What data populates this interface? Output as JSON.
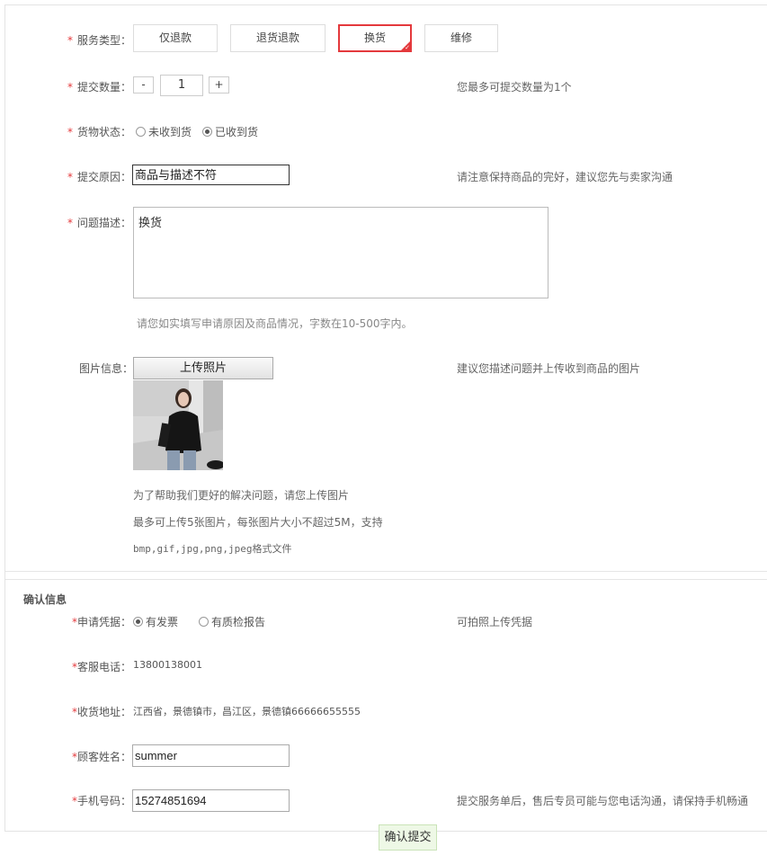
{
  "service": {
    "label": "服务类型：",
    "options": [
      "仅退款",
      "退货退款",
      "换货",
      "维修"
    ],
    "selected_index": 2
  },
  "quantity": {
    "label": "提交数量：",
    "minus": "-",
    "value": "1",
    "plus": "+",
    "hint": "您最多可提交数量为1个"
  },
  "goods_status": {
    "label": "货物状态：",
    "options": [
      "未收到货",
      "已收到货"
    ],
    "selected_index": 1
  },
  "reason": {
    "label": "提交原因：",
    "value": "商品与描述不符",
    "hint": "请注意保持商品的完好，建议您先与卖家沟通"
  },
  "description": {
    "label": "问题描述：",
    "value": "换货",
    "hint": "请您如实填写申请原因及商品情况，字数在10-500字内。"
  },
  "images": {
    "label": "图片信息：",
    "upload_label": "上传照片",
    "hint": "建议您描述问题并上传收到商品的图片",
    "notes": [
      "为了帮助我们更好的解决问题，请您上传图片",
      "最多可上传5张图片，每张图片大小不超过5M，支持",
      "bmp,gif,jpg,png,jpeg格式文件"
    ]
  },
  "confirm": {
    "section_title": "确认信息",
    "credential_label": "申请凭据：",
    "credential_options": [
      "有发票",
      "有质检报告"
    ],
    "credential_selected_index": 0,
    "credential_hint": "可拍照上传凭据",
    "phone_label": "客服电话：",
    "phone_value": "13800138001",
    "address_label": "收货地址：",
    "address_value": "江西省，景德镇市，昌江区，景德镇66666655555",
    "name_label": "顾客姓名：",
    "name_value": "summer",
    "mobile_label": "手机号码：",
    "mobile_value": "15274851694",
    "mobile_hint": "提交服务单后，售后专员可能与您电话沟通，请保持手机畅通"
  },
  "required_mark": "*",
  "submit_label": "确认提交",
  "colors": {
    "required": "#e4393c",
    "selected_border": "#e4393c",
    "submit_bg": "#eef8e6"
  }
}
